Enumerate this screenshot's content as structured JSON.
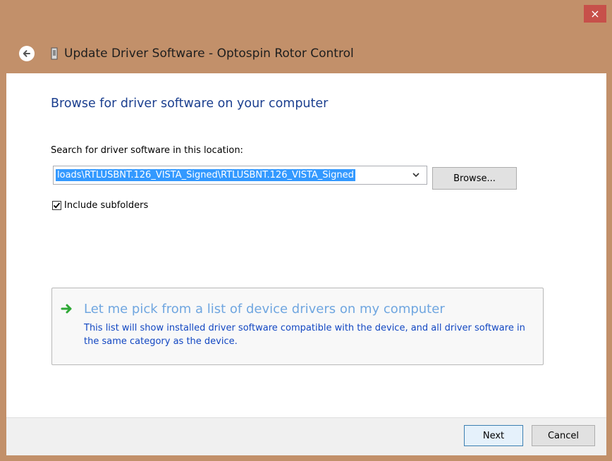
{
  "window": {
    "title": "Update Driver Software - Optospin Rotor Control",
    "close_label": "×",
    "colors": {
      "frame": "#c2906a",
      "close": "#c7504a"
    }
  },
  "main": {
    "heading": "Browse for driver software on your computer",
    "search_label": "Search for driver software in this location:",
    "path_value": "loads\\RTLUSBNT.126_VISTA_Signed\\RTLUSBNT.126_VISTA_Signed",
    "browse_label": "Browse...",
    "include_subfolders": {
      "label": "Include subfolders",
      "checked": true
    },
    "pick": {
      "title": "Let me pick from a list of device drivers on my computer",
      "description": "This list will show installed driver software compatible with the device, and all driver software in the same category as the device."
    }
  },
  "footer": {
    "next_label": "Next",
    "cancel_label": "Cancel"
  },
  "icons": [
    "back-arrow-icon",
    "device-icon",
    "dropdown-arrow-icon",
    "checkmark-icon",
    "green-arrow-icon",
    "close-icon"
  ]
}
